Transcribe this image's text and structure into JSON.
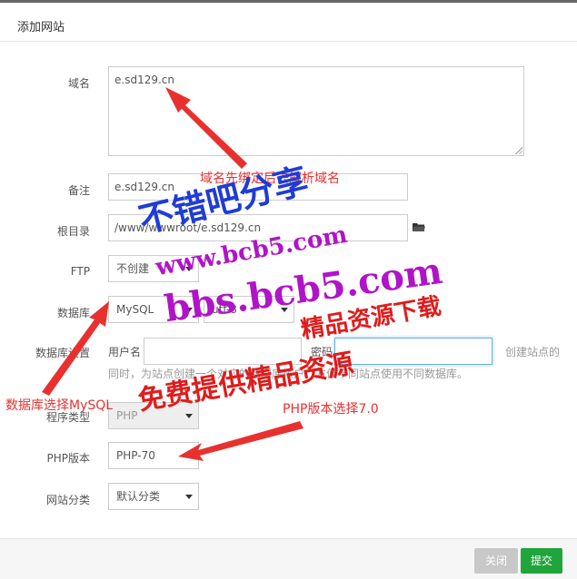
{
  "dialog": {
    "title": "添加网站"
  },
  "form": {
    "domain": {
      "label": "域名",
      "value": "e.sd129.cn"
    },
    "remark": {
      "label": "备注",
      "value": "e.sd129.cn"
    },
    "root": {
      "label": "根目录",
      "value": "/www/wwwroot/e.sd129.cn"
    },
    "ftp": {
      "label": "FTP",
      "value": "不创建"
    },
    "database": {
      "label": "数据库",
      "value": "MySQL",
      "charset": "utf-8"
    },
    "db_settings": {
      "label": "数据库设置",
      "username_label": "用户名",
      "password_label": "密码",
      "hint_right": "创建站点的",
      "hint_line2": "同时，为站点创建一个对应的数据库帐户，方便不同站点使用不同数据库。"
    },
    "program_type": {
      "label": "程序类型",
      "value": "PHP"
    },
    "php_version": {
      "label": "PHP版本",
      "value": "PHP-70"
    },
    "site_category": {
      "label": "网站分类",
      "value": "默认分类"
    }
  },
  "footer": {
    "close_label": "关闭",
    "submit_label": "提交"
  },
  "annotations": {
    "domain_note": "域名先绑定后去解析域名",
    "database_note": "数据库选择MySQL",
    "php_note": "PHP版本选择7.0"
  },
  "watermarks": {
    "line1": "不错吧分享",
    "line2": "www.bcb5.com",
    "line3": "bbs.bcb5.com",
    "line4": "精品资源下载",
    "line5": "免费提供精品资源"
  },
  "colors": {
    "accent": "#20a53a",
    "annotation": "#e8312f",
    "wm_blue": "#1f3cd6",
    "wm_purple": "#b014c8"
  }
}
